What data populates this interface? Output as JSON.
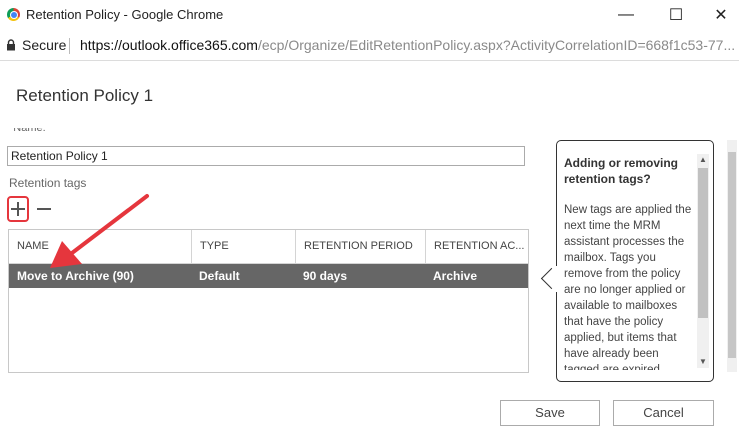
{
  "window": {
    "title": "Retention Policy - Google Chrome",
    "controls": {
      "minimize": "—",
      "maximize": "☐",
      "close": "✕"
    }
  },
  "address_bar": {
    "secure_label": "Secure",
    "url_host": "https://outlook.office365.com",
    "url_path": "/ecp/Organize/EditRetentionPolicy.aspx?ActivityCorrelationID=668f1c53-77..."
  },
  "page": {
    "title": "Retention Policy 1",
    "name_label": "*Name:",
    "name_value": "Retention Policy 1",
    "tags_label": "Retention tags"
  },
  "table": {
    "columns": [
      "NAME",
      "TYPE",
      "RETENTION PERIOD",
      "RETENTION AC..."
    ],
    "rows": [
      {
        "name": "Move to Archive (90)",
        "type": "Default",
        "period": "90 days",
        "action": "Archive",
        "selected": true
      }
    ]
  },
  "help": {
    "title": "Adding or removing retention tags?",
    "body": "New tags are applied the next time the MRM assistant processes the mailbox. Tags you remove from the policy are no longer applied or available to mailboxes that have the policy applied, but items that have already been tagged are expired"
  },
  "buttons": {
    "save": "Save",
    "cancel": "Cancel"
  },
  "colors": {
    "selected_row": "#666666",
    "annotation": "#e5363d"
  },
  "icons": {
    "add": "plus-icon",
    "remove": "minus-icon",
    "lock": "lock-icon"
  }
}
